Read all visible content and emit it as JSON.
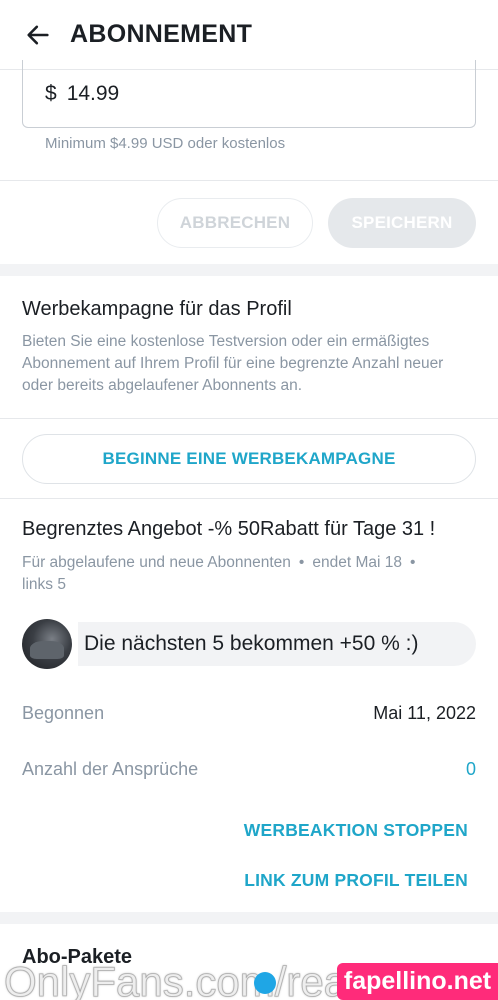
{
  "header": {
    "title": "ABONNEMENT",
    "back_icon": "arrow-left-icon"
  },
  "price": {
    "currency": "$",
    "value": "14.99",
    "hint": "Minimum $4.99 USD oder kostenlos"
  },
  "actions": {
    "cancel_label": "ABBRECHEN",
    "save_label": "SPEICHERN"
  },
  "campaign": {
    "title": "Werbekampagne für das Profil",
    "description": "Bieten Sie eine kostenlose Testversion oder ein ermäßigtes Abonnement auf Ihrem Profil für eine begrenzte Anzahl neuer oder bereits abgelaufener Abonnents an.",
    "start_label": "BEGINNE EINE WERBEKAMPAGNE"
  },
  "offer": {
    "title": "Begrenztes Angebot -% 50Rabatt für Tage 31 !",
    "audience": "Für abgelaufene und neue Abonnenten",
    "ends": "endet Mai 18",
    "left": "links 5",
    "separator": "•",
    "message": "Die nächsten 5 bekommen +50 % :)",
    "started_label": "Begonnen",
    "started_value": "Mai 11, 2022",
    "claims_label": "Anzahl der Ansprüche",
    "claims_value": "0",
    "stop_label": "WERBEAKTION STOPPEN",
    "share_label": "LINK ZUM PROFIL TEILEN"
  },
  "packages": {
    "title": "Abo-Pakete"
  },
  "watermark": {
    "left_text": "OnlyFans.com/real",
    "right_text": "fapellino.net"
  },
  "colors": {
    "accent": "#1fa6c9",
    "muted": "#8a96a3",
    "watermark_pink": "#ff2b7a"
  }
}
